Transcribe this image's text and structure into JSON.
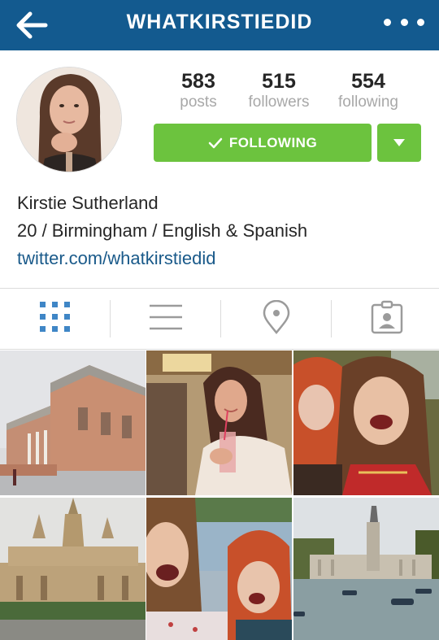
{
  "nav": {
    "title": "WHATKIRSTIEDID",
    "back_icon": "back-arrow-icon",
    "more_icon": "more-options-icon",
    "bar_color": "#135a8f"
  },
  "profile": {
    "stats": {
      "posts": {
        "value": "583",
        "label": "posts"
      },
      "followers": {
        "value": "515",
        "label": "followers"
      },
      "following": {
        "value": "554",
        "label": "following"
      }
    },
    "follow_button_label": "FOLLOWING",
    "button_color": "#6cc33e",
    "name": "Kirstie Sutherland",
    "bio": "20 / Birmingham / English & Spanish",
    "website": "twitter.com/whatkirstiedid",
    "link_color": "#1a5a8a"
  },
  "tabs": [
    {
      "name": "grid-view",
      "icon": "grid-icon",
      "active": true
    },
    {
      "name": "list-view",
      "icon": "list-icon",
      "active": false
    },
    {
      "name": "map-view",
      "icon": "location-pin-icon",
      "active": false
    },
    {
      "name": "tagged-photos",
      "icon": "tagged-person-icon",
      "active": false
    }
  ],
  "accent_color": "#3f86c6",
  "posts": [
    {
      "name": "museum-building-photo"
    },
    {
      "name": "girl-with-drink-photo"
    },
    {
      "name": "two-girls-selfie-photo"
    },
    {
      "name": "cathedral-photo"
    },
    {
      "name": "lake-selfie-photo"
    },
    {
      "name": "park-lake-monument-photo"
    }
  ]
}
